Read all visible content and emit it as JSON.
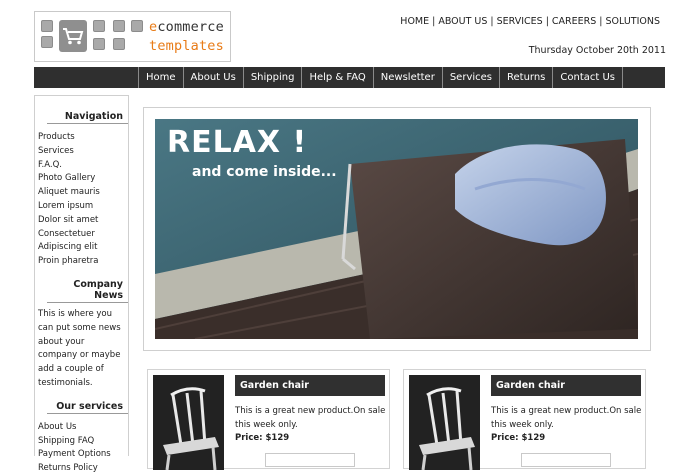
{
  "logo": {
    "line1_e": "e",
    "line1_rest": "commerce",
    "line2": "templates"
  },
  "top_links": [
    "HOME",
    "ABOUT US",
    "SERVICES",
    "CAREERS",
    "SOLUTIONS"
  ],
  "top_links_sep": "|",
  "date": "Thursday October 20th 2011",
  "nav": [
    "Home",
    "About Us",
    "Shipping",
    "Help & FAQ",
    "Newsletter",
    "Services",
    "Returns",
    "Contact Us"
  ],
  "sidebar": {
    "navigation_heading": "Navigation",
    "navigation_items": [
      "Products",
      "Services",
      "F.A.Q.",
      "Photo Gallery",
      "Aliquet mauris",
      "Lorem ipsum",
      "Dolor sit amet",
      "Consectetuer",
      "Adipiscing elit",
      "Proin pharetra"
    ],
    "news_heading": "Company News",
    "news_text": "This is where you can put some news about your company or maybe add a couple of testimonials.",
    "services_heading": "Our services",
    "services_items": [
      "About Us",
      "Shipping FAQ",
      "Payment Options",
      "Returns Policy"
    ]
  },
  "hero": {
    "title": "RELAX !",
    "subtitle": "and come inside..."
  },
  "products": [
    {
      "title": "Garden chair",
      "description": "This is a great new product.On sale this week only.",
      "price_label": "Price:",
      "price": "$129"
    },
    {
      "title": "Garden chair",
      "description": "This is a great new product.On sale this week only.",
      "price_label": "Price:",
      "price": "$129"
    }
  ],
  "colors": {
    "accent_orange": "#e87b17",
    "nav_bg": "#2f2f2f",
    "pool": "#3a6170"
  }
}
